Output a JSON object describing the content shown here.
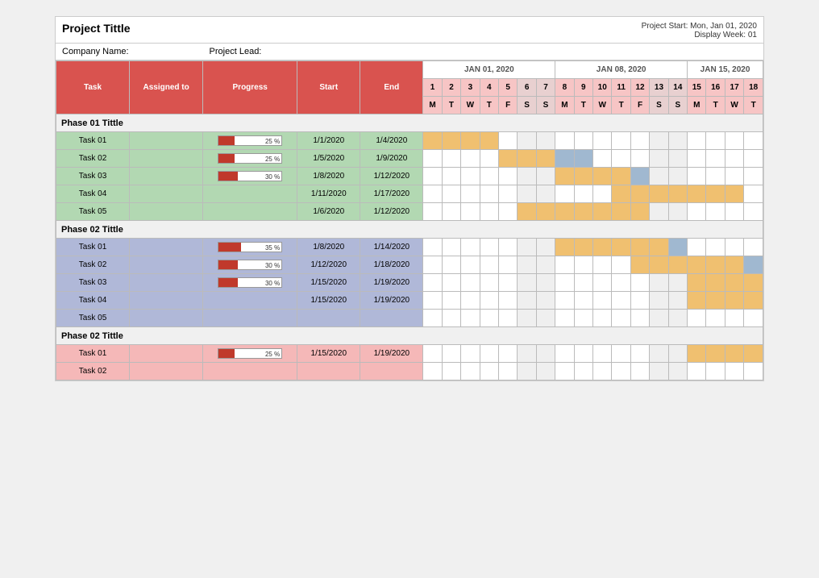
{
  "header": {
    "project_title": "Project Tittle",
    "project_start": "Project Start: Mon, Jan 01, 2020",
    "display_week": "Display Week: 01",
    "company_name": "Company Name:",
    "project_lead": "Project Lead:"
  },
  "weeks": [
    {
      "label": "JAN 01, 2020",
      "span": 7
    },
    {
      "label": "JAN 08, 2020",
      "span": 7
    },
    {
      "label": "JAN 15, 2020",
      "span": 4
    }
  ],
  "dates": [
    1,
    2,
    3,
    4,
    5,
    6,
    7,
    8,
    9,
    10,
    11,
    12,
    13,
    14,
    15,
    16,
    17,
    18
  ],
  "days": [
    "M",
    "T",
    "W",
    "T",
    "F",
    "S",
    "S",
    "M",
    "T",
    "W",
    "T",
    "F",
    "S",
    "S",
    "M",
    "T",
    "W",
    "T"
  ],
  "columns": {
    "task": "Task",
    "assigned": "Assigned to",
    "progress": "Progress",
    "start": "Start",
    "end": "End"
  },
  "phases": [
    {
      "id": "phase1",
      "title": "Phase 01 Tittle",
      "color_class": "phase1-task",
      "tasks": [
        {
          "name": "Task 01",
          "assigned": "",
          "progress": 25,
          "start": "1/1/2020",
          "end": "1/4/2020",
          "bars": [
            1,
            2,
            3,
            4
          ],
          "bar_type": "orange"
        },
        {
          "name": "Task 02",
          "assigned": "",
          "progress": 25,
          "start": "1/5/2020",
          "end": "1/9/2020",
          "bars": [
            5,
            6,
            7,
            8,
            9
          ],
          "bar_type": "mix"
        },
        {
          "name": "Task 03",
          "assigned": "",
          "progress": 30,
          "start": "1/8/2020",
          "end": "1/12/2020",
          "bars": [
            8,
            9,
            10,
            11,
            12
          ],
          "bar_type": "mix2"
        },
        {
          "name": "Task 04",
          "assigned": "",
          "progress": 0,
          "start": "1/11/2020",
          "end": "1/17/2020",
          "bars": [
            11,
            12,
            13,
            14,
            15,
            16,
            17
          ],
          "bar_type": "orange"
        },
        {
          "name": "Task 05",
          "assigned": "",
          "progress": 0,
          "start": "1/6/2020",
          "end": "1/12/2020",
          "bars": [
            6,
            7,
            8,
            9,
            10,
            11,
            12
          ],
          "bar_type": "orange"
        }
      ]
    },
    {
      "id": "phase2",
      "title": "Phase 02 Tittle",
      "color_class": "phase2-task",
      "tasks": [
        {
          "name": "Task 01",
          "assigned": "",
          "progress": 35,
          "start": "1/8/2020",
          "end": "1/14/2020",
          "bars": [
            8,
            9,
            10,
            11,
            12,
            13,
            14
          ],
          "bar_type": "mix3"
        },
        {
          "name": "Task 02",
          "assigned": "",
          "progress": 30,
          "start": "1/12/2020",
          "end": "1/18/2020",
          "bars": [
            12,
            13,
            14,
            15,
            16,
            17,
            18
          ],
          "bar_type": "mix4"
        },
        {
          "name": "Task 03",
          "assigned": "",
          "progress": 30,
          "start": "1/15/2020",
          "end": "1/19/2020",
          "bars": [
            15,
            16,
            17,
            18
          ],
          "bar_type": "orange"
        },
        {
          "name": "Task 04",
          "assigned": "",
          "progress": 0,
          "start": "1/15/2020",
          "end": "1/19/2020",
          "bars": [
            15,
            16,
            17,
            18
          ],
          "bar_type": "orange"
        },
        {
          "name": "Task 05",
          "assigned": "",
          "progress": 0,
          "start": "",
          "end": "",
          "bars": [],
          "bar_type": ""
        }
      ]
    },
    {
      "id": "phase3",
      "title": "Phase 02 Tittle",
      "color_class": "phase3-task",
      "tasks": [
        {
          "name": "Task 01",
          "assigned": "",
          "progress": 25,
          "start": "1/15/2020",
          "end": "1/19/2020",
          "bars": [
            15,
            16,
            17,
            18
          ],
          "bar_type": "orange"
        },
        {
          "name": "Task 02",
          "assigned": "",
          "progress": 0,
          "start": "",
          "end": "",
          "bars": [],
          "bar_type": ""
        }
      ]
    }
  ],
  "colors": {
    "header_bg": "#d9534f",
    "phase1_bg": "#b2d8b2",
    "phase2_bg": "#b0b8d8",
    "phase3_bg": "#f5b8b8",
    "bar_orange": "#f0c070",
    "bar_blue": "#a0b8d0",
    "progress_red": "#c0392b",
    "weekend_bg": "#e8e8e8"
  }
}
